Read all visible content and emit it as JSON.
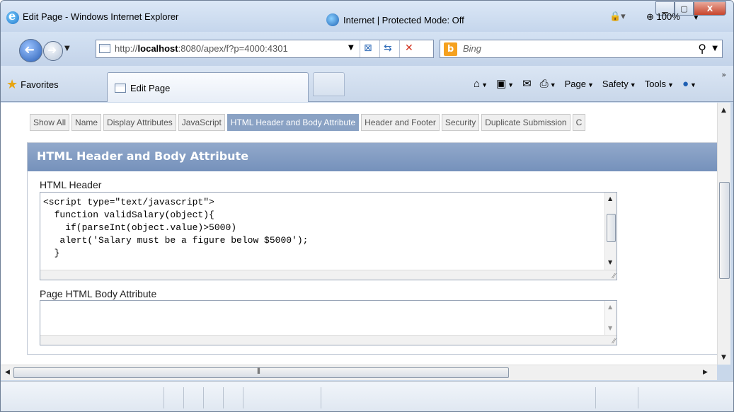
{
  "window": {
    "title": "Edit Page - Windows Internet Explorer",
    "minimize_label": "▁",
    "maximize_label": "▢",
    "close_label": "X"
  },
  "address": {
    "url_prefix": "http://",
    "url_host": "localhost",
    "url_rest": ":8080/apex/f?p=4000:4301"
  },
  "search": {
    "placeholder": "Bing"
  },
  "favorites": {
    "label": "Favorites"
  },
  "tab": {
    "label": "Edit Page"
  },
  "commandbar": {
    "page_label": "Page",
    "safety_label": "Safety",
    "tools_label": "Tools"
  },
  "subtabs": [
    {
      "label": "Show All",
      "active": false
    },
    {
      "label": "Name",
      "active": false
    },
    {
      "label": "Display Attributes",
      "active": false
    },
    {
      "label": "JavaScript",
      "active": false
    },
    {
      "label": "HTML Header and Body Attribute",
      "active": true
    },
    {
      "label": "Header and Footer",
      "active": false
    },
    {
      "label": "Security",
      "active": false
    },
    {
      "label": "Duplicate Submission",
      "active": false
    },
    {
      "label": "C",
      "active": false
    }
  ],
  "region": {
    "title": "HTML Header and Body Attribute",
    "html_header_label": "HTML Header",
    "html_header_value": "<script type=\"text/javascript\">\n  function validSalary(object){\n    if(parseInt(object.value)>5000)\n   alert('Salary must be a figure below $5000');\n  }",
    "body_attr_label": "Page HTML Body Attribute",
    "body_attr_value": ""
  },
  "status": {
    "zone": "Internet | Protected Mode: Off",
    "zoom": "100%"
  },
  "colors": {
    "region_header": "#7f98c1",
    "active_subtab": "#8aa2c4"
  }
}
